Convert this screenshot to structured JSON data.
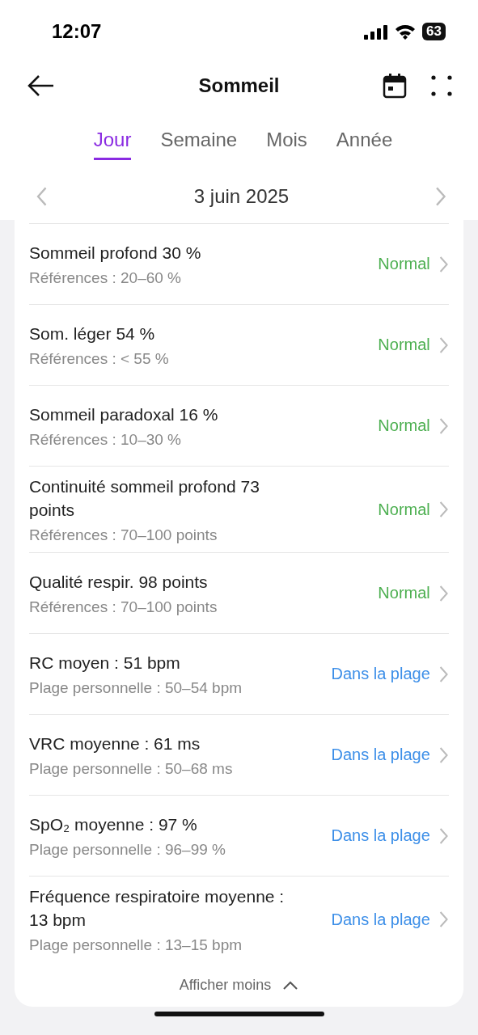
{
  "status_bar": {
    "time": "12:07",
    "battery": "63"
  },
  "header": {
    "title": "Sommeil"
  },
  "tabs": [
    {
      "label": "Jour",
      "selected": true
    },
    {
      "label": "Semaine",
      "selected": false
    },
    {
      "label": "Mois",
      "selected": false
    },
    {
      "label": "Année",
      "selected": false
    }
  ],
  "date": "3 juin 2025",
  "metrics": [
    {
      "title": "Sommeil profond 30 %",
      "reference": "Références : 20–60 %",
      "status": "Normal",
      "kind": "normal"
    },
    {
      "title": "Som. léger 54 %",
      "reference": "Références : < 55 %",
      "status": "Normal",
      "kind": "normal"
    },
    {
      "title": "Sommeil paradoxal 16 %",
      "reference": "Références : 10–30 %",
      "status": "Normal",
      "kind": "normal"
    },
    {
      "title": "Continuité sommeil profond 73 points",
      "reference": "Références : 70–100 points",
      "status": "Normal",
      "kind": "normal"
    },
    {
      "title": "Qualité respir. 98 points",
      "reference": "Références : 70–100 points",
      "status": "Normal",
      "kind": "normal"
    },
    {
      "title": "RC moyen : 51 bpm",
      "reference": "Plage personnelle : 50–54 bpm",
      "status": "Dans la plage",
      "kind": "in_range"
    },
    {
      "title": "VRC moyenne : 61 ms",
      "reference": "Plage personnelle : 50–68 ms",
      "status": "Dans la plage",
      "kind": "in_range"
    },
    {
      "title": "SpO₂ moyenne : 97 %",
      "reference": "Plage personnelle : 96–99 %",
      "status": "Dans la plage",
      "kind": "in_range"
    },
    {
      "title": "Fréquence respiratoire moyenne : 13 bpm",
      "reference": "Plage personnelle : 13–15 bpm",
      "status": "Dans la plage",
      "kind": "in_range"
    }
  ],
  "toggle": {
    "label": "Afficher moins",
    "expanded": true
  }
}
